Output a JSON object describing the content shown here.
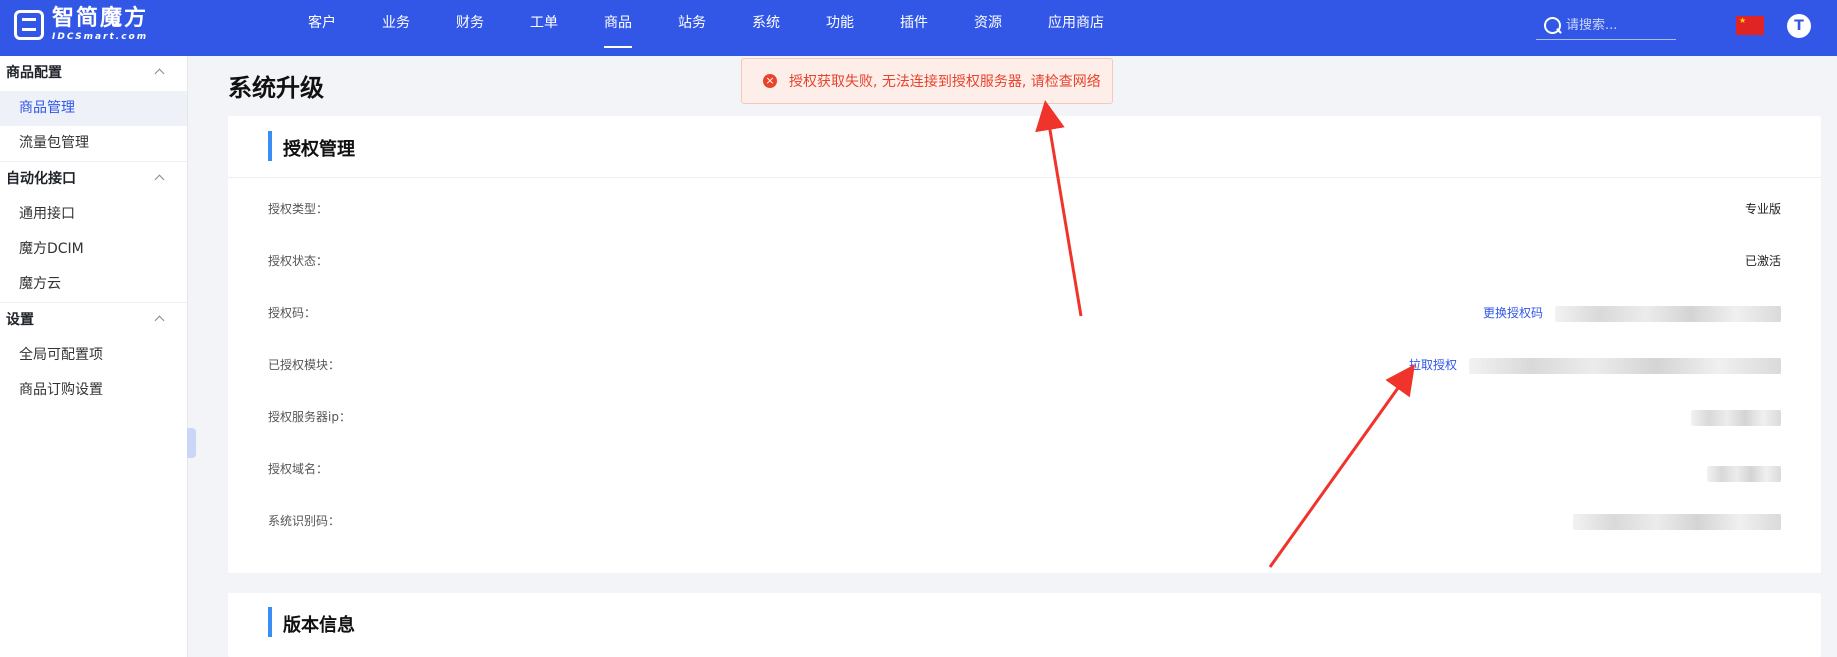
{
  "brand": {
    "name_cn": "智简魔方",
    "name_en": "IDCSmart.com"
  },
  "nav": {
    "items": [
      "客户",
      "业务",
      "财务",
      "工单",
      "商品",
      "站务",
      "系统",
      "功能",
      "插件",
      "资源",
      "应用商店"
    ],
    "active": "商品"
  },
  "search": {
    "placeholder": "请搜索..."
  },
  "user": {
    "avatar_letter": "T",
    "flag": "cn-flag"
  },
  "sidebar": {
    "groups": [
      {
        "title": "商品配置",
        "items": [
          "商品管理",
          "流量包管理"
        ]
      },
      {
        "title": "自动化接口",
        "items": [
          "通用接口",
          "魔方DCIM",
          "魔方云"
        ]
      },
      {
        "title": "设置",
        "items": [
          "全局可配置项",
          "商品订购设置"
        ]
      }
    ],
    "active_item": "商品管理"
  },
  "page": {
    "title": "系统升级"
  },
  "toast": {
    "type": "error",
    "message": "授权获取失败, 无法连接到授权服务器, 请检查网络"
  },
  "license": {
    "title": "授权管理",
    "rows": [
      {
        "label": "授权类型：",
        "value": "专业版"
      },
      {
        "label": "授权状态：",
        "value": "已激活"
      },
      {
        "label": "授权码：",
        "link": "更换授权码"
      },
      {
        "label": "已授权模块：",
        "link": "拉取授权"
      },
      {
        "label": "授权服务器ip："
      },
      {
        "label": "授权域名："
      },
      {
        "label": "系统识别码："
      }
    ]
  },
  "version": {
    "title": "版本信息"
  },
  "colors": {
    "primary": "#3257e6",
    "error": "#e8432c",
    "accent_bar": "#3a8df5",
    "arrow": "#f0342c"
  }
}
